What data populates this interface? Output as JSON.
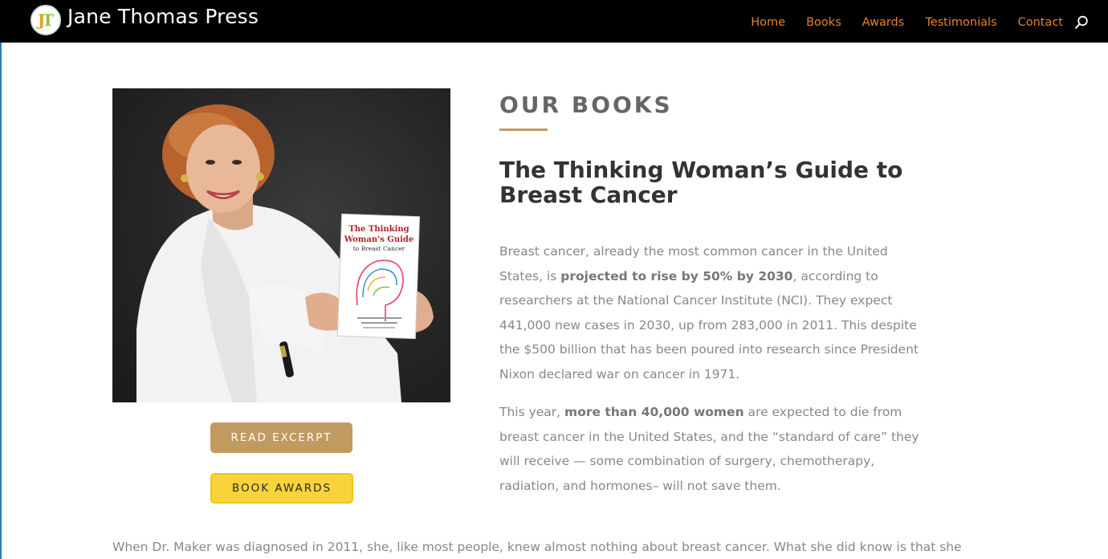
{
  "header": {
    "logo_text_j": "J",
    "logo_text_t": "T",
    "site_title": "Jane Thomas Press",
    "nav": [
      "Home",
      "Books",
      "Awards",
      "Testimonials",
      "Contact"
    ],
    "search_icon": "search-icon",
    "nav_color": "#e5832a"
  },
  "hero": {
    "book_cover": {
      "title_line1": "The Thinking",
      "title_line2": "Woman's Guide",
      "title_line3": "to Breast Cancer"
    },
    "buttons": {
      "excerpt": "READ EXCERPT",
      "awards": "BOOK AWARDS"
    }
  },
  "content": {
    "section_title": "OUR BOOKS",
    "book_title": "The Thinking Woman’s Guide to Breast Cancer",
    "p1": {
      "a": "Breast cancer, already the most common cancer in the United States, is ",
      "bold": "projected to rise by 50% by 2030",
      "b": ", according to researchers at the National Cancer Institute (NCI). They expect 441,000 new cases in 2030, up from 283,000 in 2011. This despite the $500 billion that has been poured into research since President Nixon declared war on cancer in 1971."
    },
    "p2": {
      "a": "This year, ",
      "bold": "more than 40,000 women",
      "b": " are expected to die from breast cancer in the United States, and the “standard of care” they will receive — some combination of surgery, chemotherapy, radiation, and hormones– will not save them."
    },
    "bottom": "When Dr. Maker was diagnosed in 2011, she, like most people, knew almost nothing about breast cancer. What she did know is that she"
  },
  "colors": {
    "accent_gold": "#c19a60",
    "awards_yellow": "#f8d43a",
    "header_bg": "#000000"
  }
}
